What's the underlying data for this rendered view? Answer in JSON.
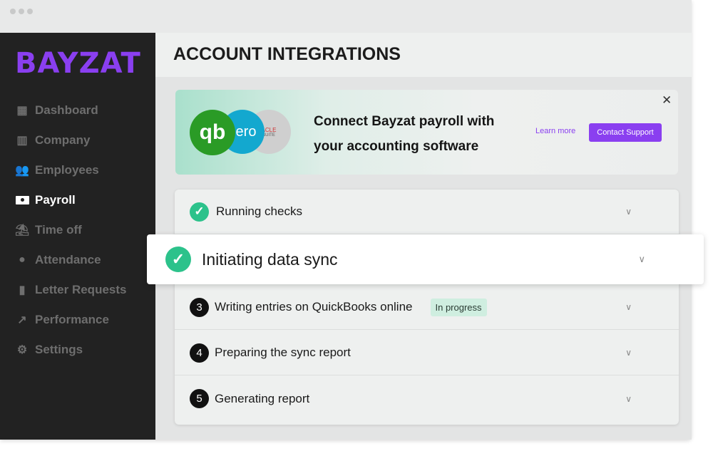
{
  "brand": {
    "logo": "BAYZAT",
    "accent": "#8a3ff0"
  },
  "sidebar": {
    "items": [
      {
        "label": "Dashboard",
        "icon": "dashboard-icon",
        "active": false
      },
      {
        "label": "Company",
        "icon": "building-icon",
        "active": false
      },
      {
        "label": "Employees",
        "icon": "users-icon",
        "active": false
      },
      {
        "label": "Payroll",
        "icon": "money-icon",
        "active": true
      },
      {
        "label": "Time off",
        "icon": "beach-umbrella-icon",
        "active": false
      },
      {
        "label": "Attendance",
        "icon": "location-pin-icon",
        "active": false
      },
      {
        "label": "Letter Requests",
        "icon": "document-icon",
        "active": false
      },
      {
        "label": "Performance",
        "icon": "trend-up-icon",
        "active": false
      },
      {
        "label": "Settings",
        "icon": "gear-icon",
        "active": false
      }
    ]
  },
  "header": {
    "title": "ACCOUNT INTEGRATIONS"
  },
  "banner": {
    "line1": "Connect Bayzat payroll with",
    "line2": "your accounting software",
    "learn_more": "Learn more",
    "contact": "Contact Support",
    "logos": {
      "quickbooks": "qb",
      "xero": "ero",
      "oracle": "ACLE",
      "oracle_sub": "SUITE"
    }
  },
  "steps": [
    {
      "label": "Running checks",
      "status": "done"
    },
    {
      "label": "Initiating data sync",
      "status": "done"
    },
    {
      "number": "3",
      "label": "Writing entries on QuickBooks online",
      "badge": "In progress"
    },
    {
      "number": "4",
      "label": "Preparing the sync report"
    },
    {
      "number": "5",
      "label": "Generating report"
    }
  ]
}
